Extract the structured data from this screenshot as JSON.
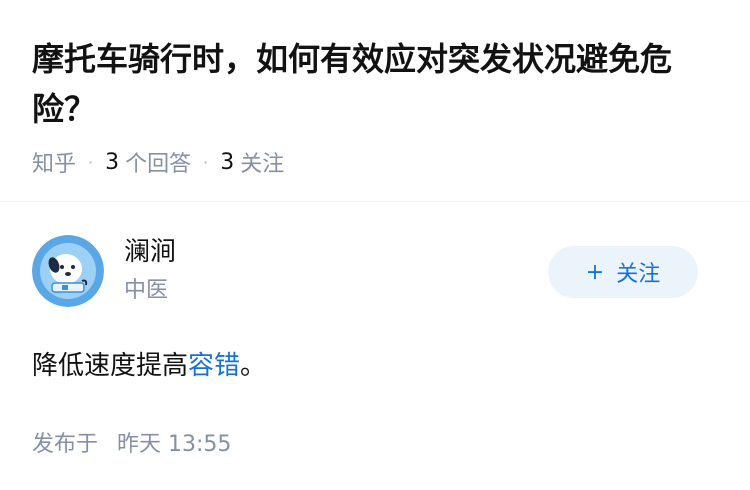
{
  "question": {
    "title": "摩托车骑行时，如何有效应对突发状况避免危险？",
    "source": "知乎",
    "answer_count": "3",
    "answer_label": "个回答",
    "follow_count": "3",
    "follow_label": "关注"
  },
  "answer": {
    "author_name": "澜涧",
    "author_bio": "中医",
    "follow_button": "关注",
    "text_before": "降低速度提高",
    "text_link": "容错",
    "text_after": "。",
    "published_label": "发布于",
    "published_date": "昨天 13:55"
  },
  "colors": {
    "accent": "#1772d8",
    "follow_bg": "#ebf3fb",
    "meta_text": "#8590a6",
    "avatar_bg": "#5aa7e6"
  }
}
